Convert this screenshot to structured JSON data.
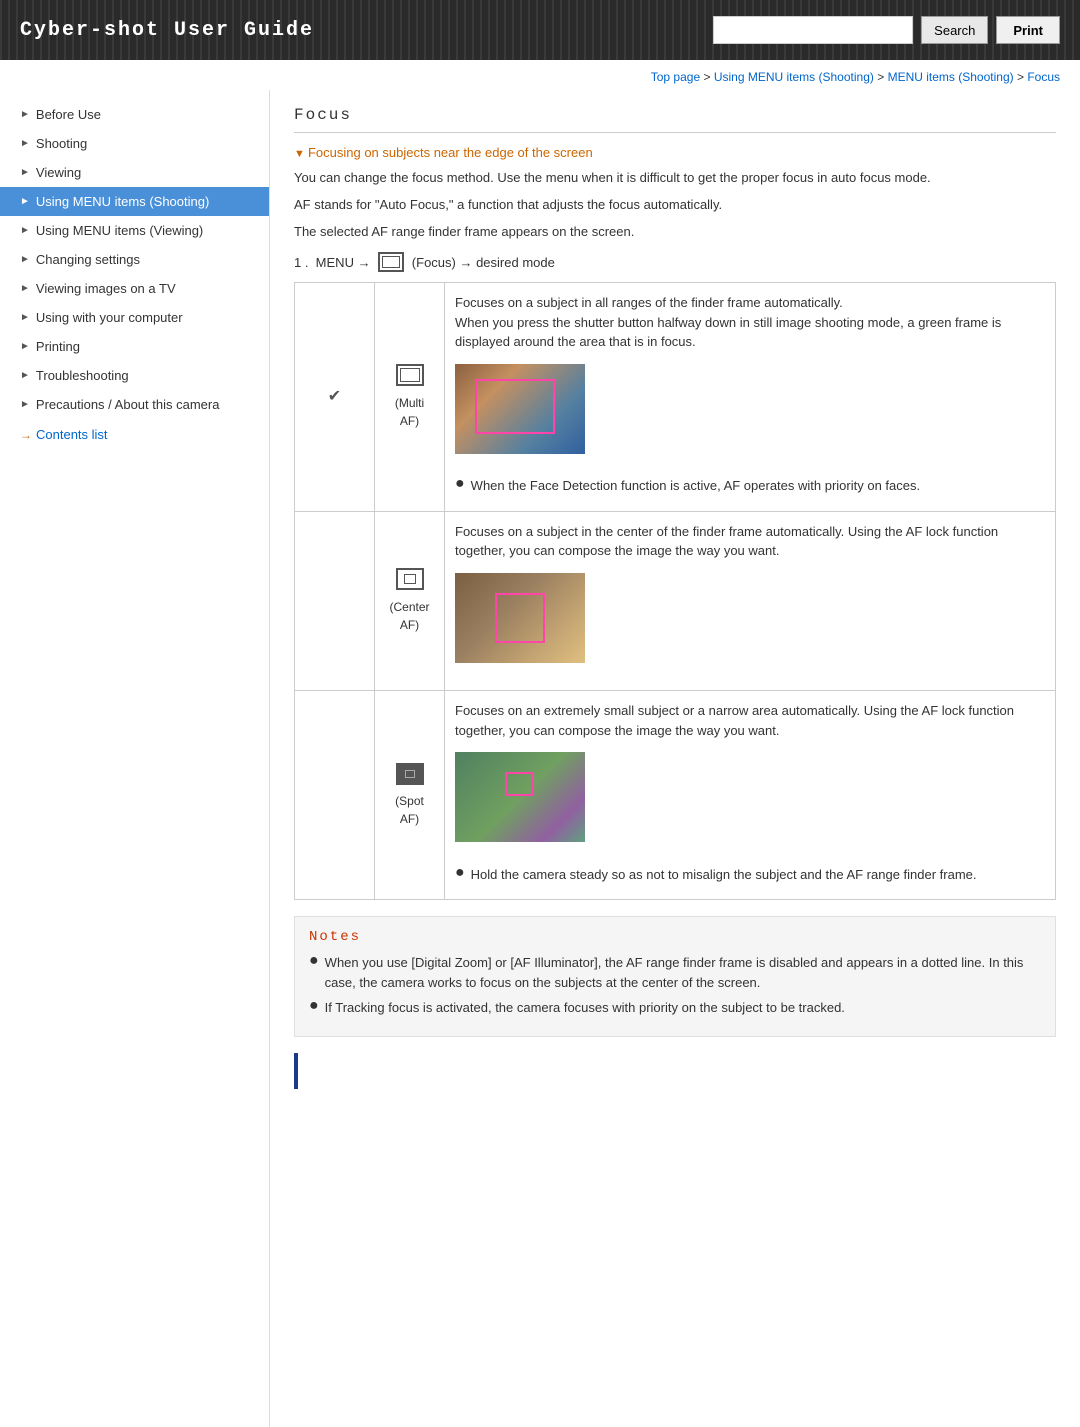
{
  "header": {
    "title": "Cyber-shot User Guide",
    "search_placeholder": "",
    "search_label": "Search",
    "print_label": "Print"
  },
  "breadcrumb": {
    "items": [
      "Top page",
      "Using MENU items (Shooting)",
      "MENU items (Shooting)",
      "Focus"
    ],
    "separator": " > "
  },
  "sidebar": {
    "items": [
      {
        "id": "before-use",
        "label": "Before Use",
        "active": false
      },
      {
        "id": "shooting",
        "label": "Shooting",
        "active": false
      },
      {
        "id": "viewing",
        "label": "Viewing",
        "active": false
      },
      {
        "id": "using-menu-shooting",
        "label": "Using MENU items (Shooting)",
        "active": true
      },
      {
        "id": "using-menu-viewing",
        "label": "Using MENU items (Viewing)",
        "active": false
      },
      {
        "id": "changing-settings",
        "label": "Changing settings",
        "active": false
      },
      {
        "id": "viewing-tv",
        "label": "Viewing images on a TV",
        "active": false
      },
      {
        "id": "using-computer",
        "label": "Using with your computer",
        "active": false
      },
      {
        "id": "printing",
        "label": "Printing",
        "active": false
      },
      {
        "id": "troubleshooting",
        "label": "Troubleshooting",
        "active": false
      },
      {
        "id": "precautions",
        "label": "Precautions / About this camera",
        "active": false
      }
    ],
    "contents_link": "Contents list"
  },
  "content": {
    "page_title": "Focus",
    "section_link": "Focusing on subjects near the edge of the screen",
    "intro_lines": [
      "You can change the focus method. Use the menu when it is difficult to get the proper focus in auto focus mode.",
      "AF stands for \"Auto Focus,\" a function that adjusts the focus automatically.",
      "The selected AF range finder frame appears on the screen."
    ],
    "menu_instruction": "1 .  MENU →    (Focus) → desired mode",
    "focus_modes": [
      {
        "id": "multi-af",
        "icon_label": "(Multi AF)",
        "description": "Focuses on a subject in all ranges of the finder frame automatically.\nWhen you press the shutter button halfway down in still image shooting mode, a green frame is displayed around the area that is in focus.",
        "bullet": "When the Face Detection function is active, AF operates with priority on faces.",
        "has_image": true,
        "image_type": "multi"
      },
      {
        "id": "center-af",
        "icon_label": "(Center AF)",
        "description": "Focuses on a subject in the center of the finder frame automatically. Using the AF lock function together, you can compose the image the way you want.",
        "bullet": null,
        "has_image": true,
        "image_type": "center"
      },
      {
        "id": "spot-af",
        "icon_label": "(Spot AF)",
        "description": "Focuses on an extremely small subject or a narrow area automatically. Using the AF lock function together, you can compose the image the way you want.",
        "bullet": "Hold the camera steady so as not to misalign the subject and the AF range finder frame.",
        "has_image": true,
        "image_type": "spot"
      }
    ],
    "notes": {
      "title": "Notes",
      "items": [
        "When you use [Digital Zoom] or [AF Illuminator], the AF range finder frame is disabled and appears in a dotted line. In this case, the camera works to focus on the subjects at the center of the screen.",
        "If Tracking focus is activated, the camera focuses with priority on the subject to be tracked."
      ]
    }
  }
}
